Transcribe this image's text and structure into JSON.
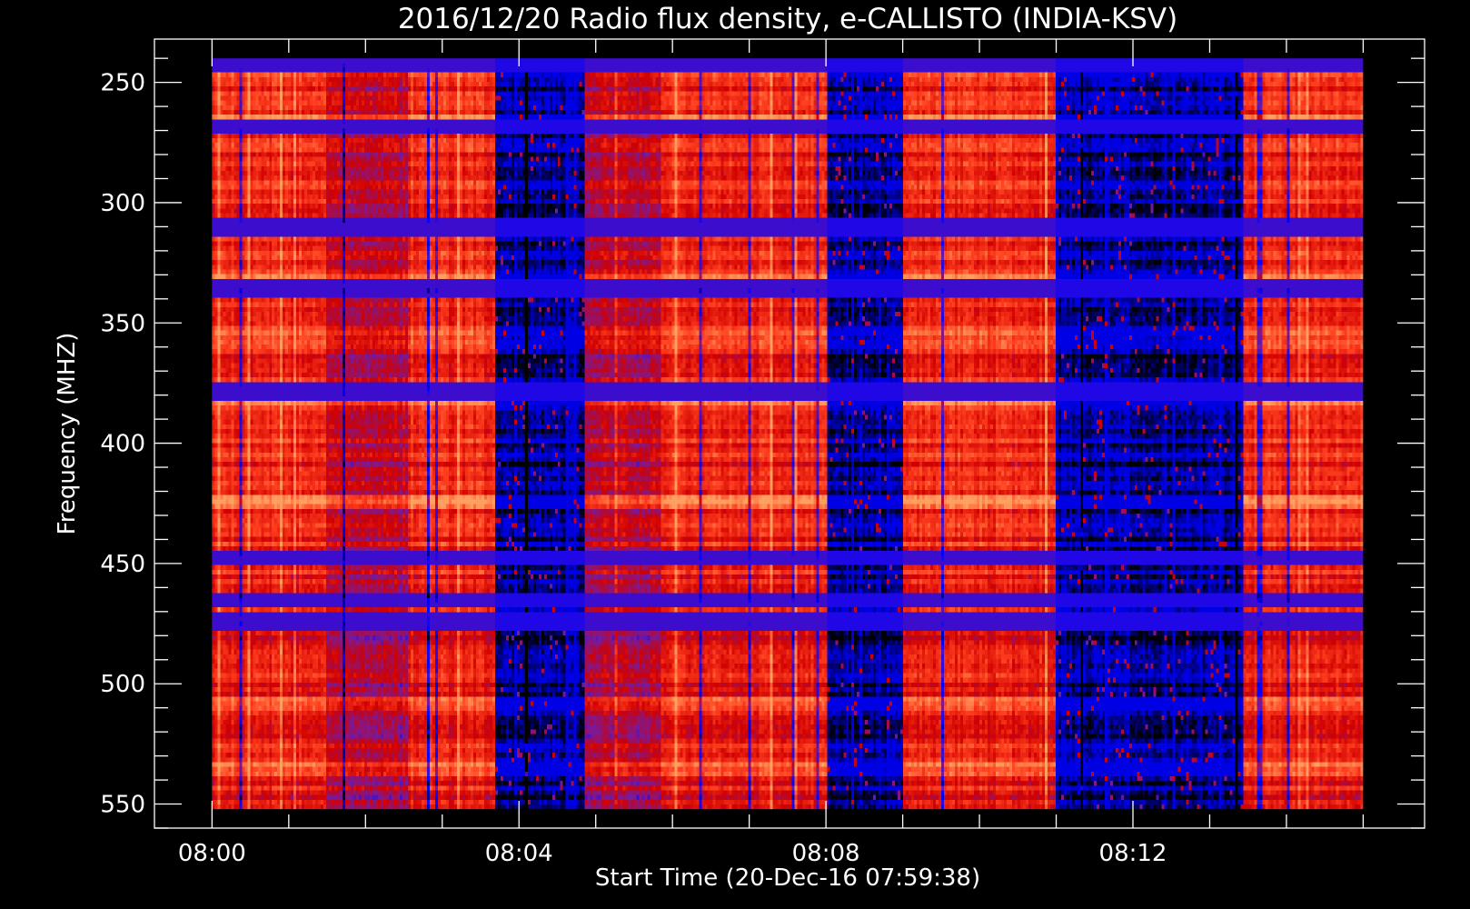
{
  "chart_data": {
    "type": "heatmap",
    "title": "2016/12/20  Radio flux density, e-CALLISTO (INDIA-KSV)",
    "xlabel": "Start Time (20-Dec-16 07:59:38)",
    "ylabel": "Frequency (MHZ)",
    "x_ticks": [
      "08:00",
      "08:04",
      "08:08",
      "08:12"
    ],
    "x_tick_minutes": [
      0,
      4,
      8,
      12
    ],
    "x_range_minutes": [
      -0.75,
      15.8
    ],
    "data_x_range_minutes": [
      0,
      15.0
    ],
    "y_ticks": [
      "250",
      "300",
      "350",
      "400",
      "450",
      "500",
      "550"
    ],
    "y_tick_values": [
      250,
      300,
      350,
      400,
      450,
      500,
      550
    ],
    "ylim": [
      232,
      560
    ],
    "data_y_range": [
      240,
      552
    ],
    "y_reversed": true,
    "colormap": [
      "#000000",
      "#0000ff",
      "#7a1a9a",
      "#d00000",
      "#ff4020",
      "#ffa060"
    ],
    "segments": [
      {
        "start_min": 0.0,
        "end_min": 1.5,
        "level": "high"
      },
      {
        "start_min": 1.5,
        "end_min": 2.55,
        "level": "mid"
      },
      {
        "start_min": 2.55,
        "end_min": 3.7,
        "level": "high"
      },
      {
        "start_min": 3.7,
        "end_min": 4.85,
        "level": "low"
      },
      {
        "start_min": 4.85,
        "end_min": 5.85,
        "level": "mid"
      },
      {
        "start_min": 5.85,
        "end_min": 8.0,
        "level": "high"
      },
      {
        "start_min": 8.0,
        "end_min": 9.0,
        "level": "low"
      },
      {
        "start_min": 9.0,
        "end_min": 11.0,
        "level": "high"
      },
      {
        "start_min": 11.0,
        "end_min": 13.45,
        "level": "low"
      },
      {
        "start_min": 13.45,
        "end_min": 15.0,
        "level": "high"
      }
    ],
    "bright_bands_mhz": [
      241,
      266,
      312,
      332,
      357,
      384,
      425,
      508,
      535
    ],
    "blue_bands_mhz": [
      243,
      268,
      310,
      335,
      378,
      448,
      465,
      474
    ],
    "notes": [
      "High-frequency half (>455 MHz) shows step discontinuity at 455 MHz"
    ]
  }
}
